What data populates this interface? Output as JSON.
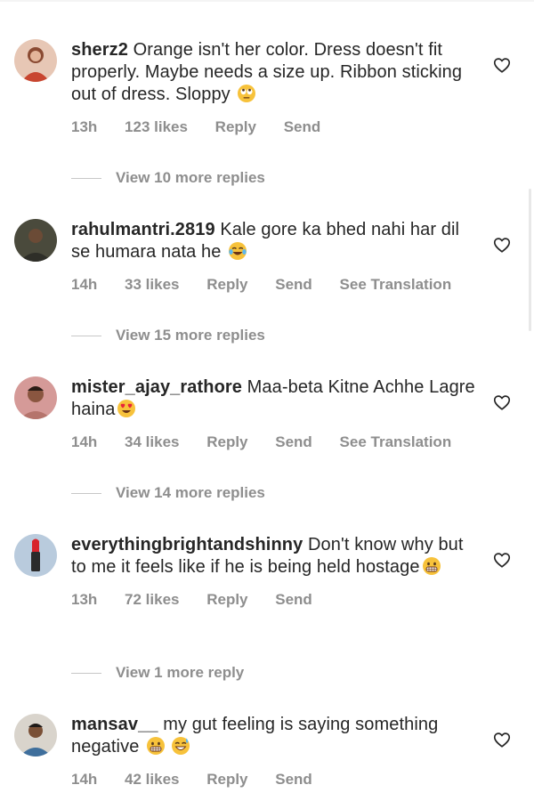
{
  "comments": [
    {
      "username": "sherz2",
      "text": " Orange isn't her color. Dress doesn't fit properly. Maybe needs a size up. Ribbon sticking out of dress. Sloppy ",
      "emoji": "rolling-eyes",
      "time": "13h",
      "likes": "123 likes",
      "reply": "Reply",
      "send": "Send",
      "translation": "",
      "view_replies": "View 10 more replies",
      "avatar_color": "#b84040"
    },
    {
      "username": "rahulmantri.2819",
      "text": " Kale gore ka bhed nahi har dil se humara nata he ",
      "emoji": "tears-of-joy",
      "time": "14h",
      "likes": "33 likes",
      "reply": "Reply",
      "send": "Send",
      "translation": "See Translation",
      "view_replies": "View 15 more replies",
      "avatar_color": "#3a3a2e"
    },
    {
      "username": "mister_ajay_rathore",
      "text": " Maa-beta Kitne Achhe Lagre haina",
      "emoji": "heart-eyes",
      "time": "14h",
      "likes": "34 likes",
      "reply": "Reply",
      "send": "Send",
      "translation": "See Translation",
      "view_replies": "View 14 more replies",
      "avatar_color": "#c77a7a"
    },
    {
      "username": "everythingbrightandshinny",
      "text": " Don't know why but to me it feels like if he is being held hostage",
      "emoji": "grimacing",
      "time": "13h",
      "likes": "72 likes",
      "reply": "Reply",
      "send": "Send",
      "translation": "",
      "view_replies": "View 1 more reply",
      "avatar_color": "#9fb4cc"
    },
    {
      "username": "mansav__",
      "text": " my gut feeling is saying something negative ",
      "emoji": "grimacing-sweat",
      "time": "14h",
      "likes": "42 likes",
      "reply": "Reply",
      "send": "Send",
      "translation": "",
      "view_replies": "",
      "avatar_color": "#3f6f9c"
    }
  ],
  "colors": {
    "text": "#262626",
    "meta": "#8e8e8e",
    "emoji_yellow": "#f7c23b"
  }
}
